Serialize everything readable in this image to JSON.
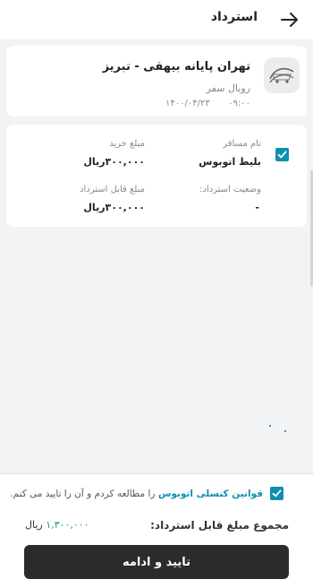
{
  "header": {
    "title": "استرداد",
    "back_icon": "arrow-right-icon"
  },
  "trip": {
    "logo_icon": "bus-company-logo-icon",
    "route": "تهران پایانه بیهقی - تبریز",
    "company": "رویال سفر",
    "date": "۱۴۰۰/۰۴/۲۳",
    "time": "۰۹:۰۰"
  },
  "passenger": {
    "checked": true,
    "name_label": "نام مسافر",
    "name_value": "بلیط اتوبوس",
    "purchase_label": "مبلغ خرید",
    "purchase_value": "۳۰۰,۰۰۰ریال",
    "refund_status_label": "وضعیت استرداد:",
    "refund_status_value": "-",
    "refundable_label": "مبلغ قابل استرداد",
    "refundable_value": "۳۰۰,۰۰۰ریال"
  },
  "footer": {
    "terms_checked": true,
    "terms_link": "قوانین کنسلی اتوبوس",
    "terms_text": "را مطالعه کردم و آن را تایید می کنم.",
    "total_label": "مجموع مبلغ قابل استرداد:",
    "total_amount": "۱,۳۰۰,۰۰۰",
    "total_currency": "ریال",
    "confirm_button": "تایید و ادامه"
  },
  "colors": {
    "accent": "#0f8fb0",
    "button_bg": "#2b2b2b",
    "amount_green": "#1f9e5c",
    "page_bg": "#f2f3f5"
  }
}
